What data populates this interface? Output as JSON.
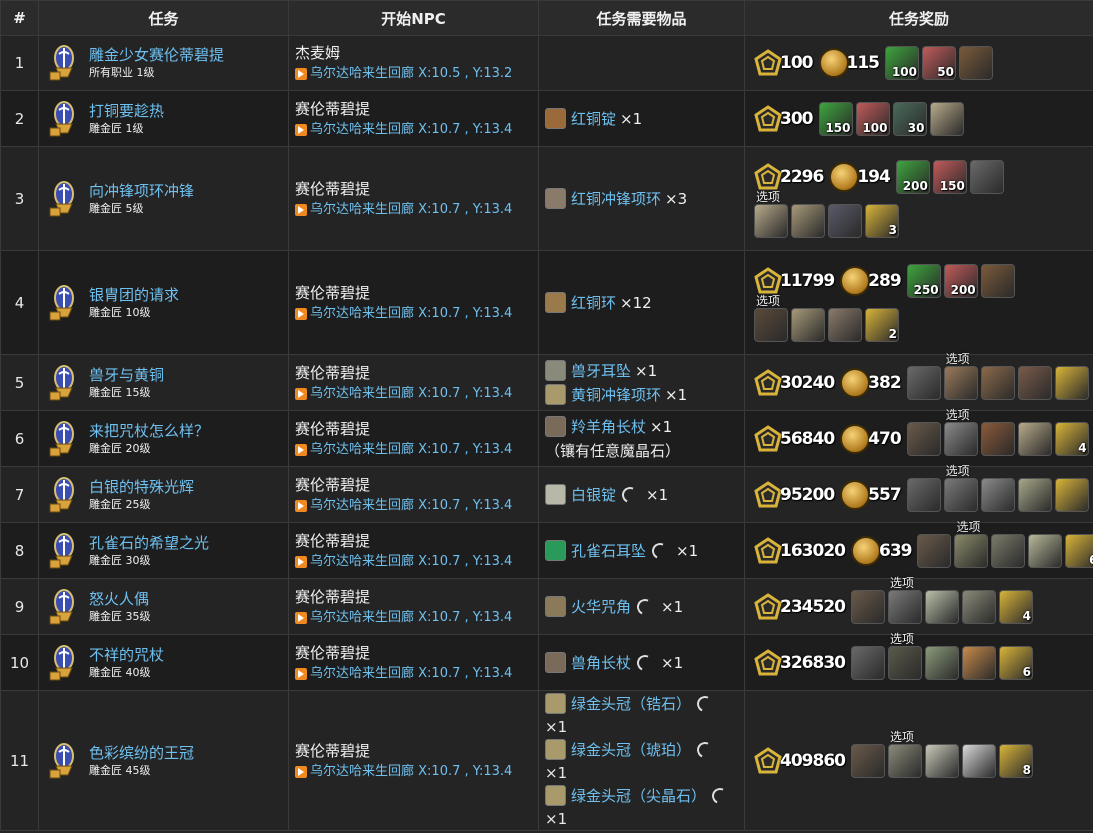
{
  "headers": [
    "#",
    "任务",
    "开始NPC",
    "任务需要物品",
    "任务奖励"
  ],
  "option_label": "选项",
  "rows": [
    {
      "n": "1",
      "name": "雕金少女赛伦蒂碧提",
      "sub": "所有职业 1级",
      "npc": "杰麦姆",
      "loc": "乌尔达哈来生回廊 X:10.5 , Y:13.2",
      "items": [],
      "xp": "100",
      "gil": "115",
      "slots": [
        {
          "c": "#3da53d",
          "q": "100"
        },
        {
          "c": "#c25a5a",
          "q": "50"
        },
        {
          "c": "#7a5a3a",
          "q": ""
        }
      ],
      "opts": []
    },
    {
      "n": "2",
      "name": "打铜要趁热",
      "sub": "雕金匠 1级",
      "npc": "赛伦蒂碧提",
      "loc": "乌尔达哈来生回廊 X:10.7 , Y:13.4",
      "items": [
        {
          "t": "红铜锭",
          "hq": false,
          "cnt": "×1",
          "c": "#9a6a3a"
        }
      ],
      "xp": "300",
      "gil": "",
      "slots": [
        {
          "c": "#3da53d",
          "q": "150"
        },
        {
          "c": "#c25a5a",
          "q": "100"
        },
        {
          "c": "#4a6a5a",
          "q": "30"
        },
        {
          "c": "#b8ab8a",
          "q": ""
        }
      ],
      "opts": []
    },
    {
      "n": "3",
      "name": "向冲锋项环冲锋",
      "sub": "雕金匠 5级",
      "npc": "赛伦蒂碧提",
      "loc": "乌尔达哈来生回廊 X:10.7 , Y:13.4",
      "items": [
        {
          "t": "红铜冲锋项环",
          "hq": false,
          "cnt": "×3",
          "c": "#8a7a6a"
        }
      ],
      "xp": "2296",
      "gil": "194",
      "slots": [
        {
          "c": "#3da53d",
          "q": "200"
        },
        {
          "c": "#c25a5a",
          "q": "150"
        },
        {
          "c": "#6a6a6a",
          "q": ""
        }
      ],
      "opts": [
        {
          "c": "#b8ab8a",
          "q": ""
        },
        {
          "c": "#a89a7a",
          "q": ""
        },
        {
          "c": "#5a5a6a",
          "q": ""
        },
        {
          "c": "#d8b43a",
          "q": "3"
        }
      ]
    },
    {
      "n": "4",
      "name": "银胄团的请求",
      "sub": "雕金匠 10级",
      "npc": "赛伦蒂碧提",
      "loc": "乌尔达哈来生回廊 X:10.7 , Y:13.4",
      "items": [
        {
          "t": "红铜环",
          "hq": false,
          "cnt": "×12",
          "c": "#9a7a4a"
        }
      ],
      "xp": "11799",
      "gil": "289",
      "slots": [
        {
          "c": "#3da53d",
          "q": "250"
        },
        {
          "c": "#c25a5a",
          "q": "200"
        },
        {
          "c": "#7a5a3a",
          "q": ""
        }
      ],
      "opts": [
        {
          "c": "#5a4a3a",
          "q": ""
        },
        {
          "c": "#a89a7a",
          "q": ""
        },
        {
          "c": "#8a7a6a",
          "q": ""
        },
        {
          "c": "#d8b43a",
          "q": "2"
        }
      ]
    },
    {
      "n": "5",
      "name": "兽牙与黄铜",
      "sub": "雕金匠 15级",
      "npc": "赛伦蒂碧提",
      "loc": "乌尔达哈来生回廊 X:10.7 , Y:13.4",
      "items": [
        {
          "t": "兽牙耳坠",
          "hq": false,
          "cnt": "×1",
          "c": "#8a8a7a"
        },
        {
          "t": "黄铜冲锋项环",
          "hq": false,
          "cnt": "×1",
          "c": "#a89a6a"
        }
      ],
      "xp": "30240",
      "gil": "382",
      "slots": [
        {
          "c": "#6a6a6a",
          "q": ""
        }
      ],
      "opts": [
        {
          "c": "#9a7a5a",
          "q": ""
        },
        {
          "c": "#8a6a4a",
          "q": ""
        },
        {
          "c": "#7a5a4a",
          "q": ""
        },
        {
          "c": "#d8b43a",
          "q": ""
        }
      ]
    },
    {
      "n": "6",
      "name": "来把咒杖怎么样？",
      "sub": "雕金匠 20级",
      "npc": "赛伦蒂碧提",
      "loc": "乌尔达哈来生回廊 X:10.7 , Y:13.4",
      "items": [
        {
          "t": "羚羊角长杖",
          "hq": false,
          "cnt": "×1",
          "c": "#7a6a5a",
          "note": "（镶有任意魔晶石）"
        }
      ],
      "xp": "56840",
      "gil": "470",
      "slots": [
        {
          "c": "#6a5a4a",
          "q": ""
        }
      ],
      "opts": [
        {
          "c": "#8a8a8a",
          "q": ""
        },
        {
          "c": "#8a5a3a",
          "q": ""
        },
        {
          "c": "#b8ab8a",
          "q": ""
        },
        {
          "c": "#d8b43a",
          "q": "4"
        }
      ]
    },
    {
      "n": "7",
      "name": "白银的特殊光辉",
      "sub": "雕金匠 25级",
      "npc": "赛伦蒂碧提",
      "loc": "乌尔达哈来生回廊 X:10.7 , Y:13.4",
      "items": [
        {
          "t": "白银锭",
          "hq": true,
          "cnt": "×1",
          "c": "#b8b8a8"
        }
      ],
      "xp": "95200",
      "gil": "557",
      "slots": [
        {
          "c": "#6a6a6a",
          "q": ""
        }
      ],
      "opts": [
        {
          "c": "#7a7a7a",
          "q": ""
        },
        {
          "c": "#8a8a8a",
          "q": ""
        },
        {
          "c": "#a8a88a",
          "q": ""
        },
        {
          "c": "#d8b43a",
          "q": ""
        }
      ]
    },
    {
      "n": "8",
      "name": "孔雀石的希望之光",
      "sub": "雕金匠 30级",
      "npc": "赛伦蒂碧提",
      "loc": "乌尔达哈来生回廊 X:10.7 , Y:13.4",
      "items": [
        {
          "t": "孔雀石耳坠",
          "hq": true,
          "cnt": "×1",
          "c": "#2a9a5a"
        }
      ],
      "xp": "163020",
      "gil": "639",
      "slots": [
        {
          "c": "#6a5a4a",
          "q": ""
        }
      ],
      "opts": [
        {
          "c": "#8a8a6a",
          "q": ""
        },
        {
          "c": "#7a7a6a",
          "q": ""
        },
        {
          "c": "#b8b89a",
          "q": ""
        },
        {
          "c": "#d8b43a",
          "q": "6"
        }
      ]
    },
    {
      "n": "9",
      "name": "怒火人偶",
      "sub": "雕金匠 35级",
      "npc": "赛伦蒂碧提",
      "loc": "乌尔达哈来生回廊 X:10.7 , Y:13.4",
      "items": [
        {
          "t": "火华咒角",
          "hq": true,
          "cnt": "×1",
          "c": "#8a7a5a"
        }
      ],
      "xp": "234520",
      "gil": "",
      "slots": [
        {
          "c": "#6a5a4a",
          "q": ""
        }
      ],
      "opts": [
        {
          "c": "#7a7a7a",
          "q": ""
        },
        {
          "c": "#b8c0a8",
          "q": ""
        },
        {
          "c": "#8a8a7a",
          "q": ""
        },
        {
          "c": "#d8b43a",
          "q": "4"
        }
      ]
    },
    {
      "n": "10",
      "name": "不祥的咒杖",
      "sub": "雕金匠 40级",
      "npc": "赛伦蒂碧提",
      "loc": "乌尔达哈来生回廊 X:10.7 , Y:13.4",
      "items": [
        {
          "t": "兽角长杖",
          "hq": true,
          "cnt": "×1",
          "c": "#7a6a5a"
        }
      ],
      "xp": "326830",
      "gil": "",
      "slots": [
        {
          "c": "#6a6a6a",
          "q": ""
        }
      ],
      "opts": [
        {
          "c": "#5a5a4a",
          "q": ""
        },
        {
          "c": "#8a9a7a",
          "q": ""
        },
        {
          "c": "#c88a4a",
          "q": ""
        },
        {
          "c": "#d8b43a",
          "q": "6"
        }
      ]
    },
    {
      "n": "11",
      "name": "色彩缤纷的王冠",
      "sub": "雕金匠 45级",
      "npc": "赛伦蒂碧提",
      "loc": "乌尔达哈来生回廊 X:10.7 , Y:13.4",
      "items": [
        {
          "t": "绿金头冠（锆石）",
          "hq": true,
          "cnt": "×1",
          "c": "#a89a6a",
          "wrap": true
        },
        {
          "t": "绿金头冠（琥珀）",
          "hq": true,
          "cnt": "×1",
          "c": "#a89a6a",
          "wrap": true
        },
        {
          "t": "绿金头冠（尖晶石）",
          "hq": true,
          "cnt": "×1",
          "c": "#a89a6a",
          "wrap": true
        }
      ],
      "xp": "409860",
      "gil": "",
      "slots": [
        {
          "c": "#6a5a4a",
          "q": ""
        }
      ],
      "opts": [
        {
          "c": "#8a8a7a",
          "q": ""
        },
        {
          "c": "#c8c8b8",
          "q": ""
        },
        {
          "c": "#d8d8d8",
          "q": ""
        },
        {
          "c": "#d8b43a",
          "q": "8"
        }
      ]
    }
  ]
}
